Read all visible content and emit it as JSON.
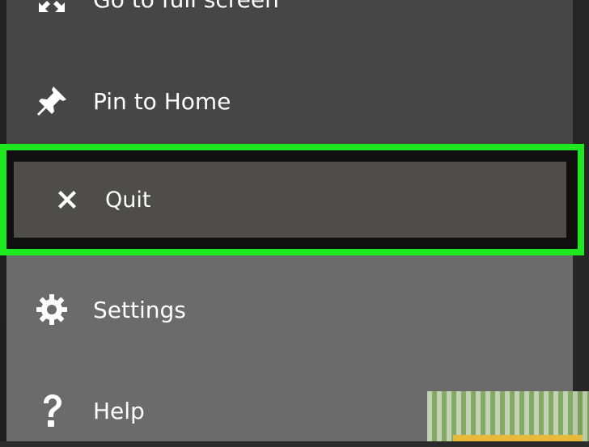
{
  "menu": {
    "items": [
      {
        "id": "fullscreen",
        "label": "Go to full screen",
        "icon": "fullscreen-icon"
      },
      {
        "id": "pin",
        "label": "Pin to Home",
        "icon": "pin-icon"
      },
      {
        "id": "quit",
        "label": "Quit",
        "icon": "close-icon",
        "selected": true
      },
      {
        "id": "settings",
        "label": "Settings",
        "icon": "gear-icon"
      },
      {
        "id": "help",
        "label": "Help",
        "icon": "question-icon"
      }
    ]
  },
  "colors": {
    "highlight": "#1ee81e",
    "upper_panel": "#464646",
    "lower_panel": "#6b6b6b",
    "selected_item": "#4f4c4c",
    "text": "#ffffff"
  }
}
